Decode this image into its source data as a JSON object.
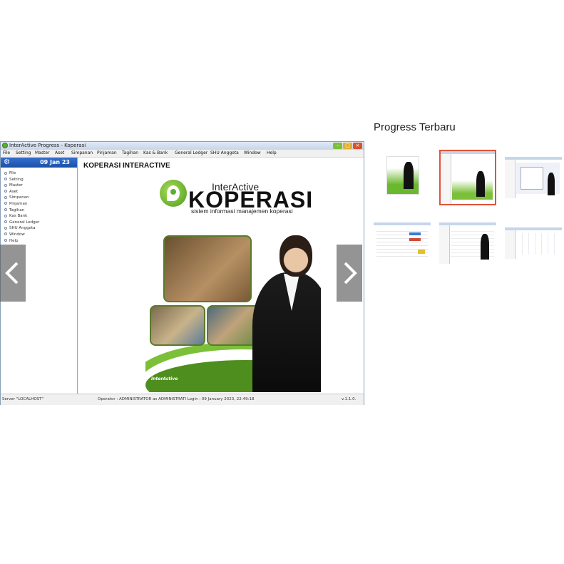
{
  "window": {
    "title": "InterActive Progress - Koperasi",
    "controls": {
      "minimize": "–",
      "maximize": "□",
      "close": "×"
    },
    "menu": [
      "File",
      "Setting",
      "Master",
      "Aset",
      "Simpanan",
      "Pinjaman",
      "Tagihan",
      "Kas & Bank",
      "General Ledger",
      "SHU Anggota",
      "Window",
      "Help"
    ],
    "sidebar": {
      "date": "09 Jan 23",
      "items": [
        "File",
        "Setting",
        "Master",
        "Aset",
        "Simpanan",
        "Pinjaman",
        "Tagihan",
        "Kas  Bank",
        "General Ledger",
        "SHU Anggota",
        "Window",
        "Help"
      ]
    },
    "main": {
      "heading": "KOPERASI INTERACTIVE",
      "cover": {
        "logo_top": "InterActive",
        "logo_main": "KOPERASI",
        "logo_sub": "sistem informasi manajemen koperasi",
        "brand_small": "InterActive"
      }
    },
    "status": {
      "server": "Server \"LOCALHOST\"",
      "operator": "Operator : ADMINISTRATOR as ADMINISTRATI Login : 09 January 2023, 22:49:18",
      "version": "v.1.1.0."
    }
  },
  "gallery": {
    "title": "Progress Terbaru",
    "selected_index": 1,
    "thumbnail_count": 6
  },
  "colors": {
    "accent_green": "#5fae2e",
    "date_header": "#1b4fa8",
    "thumb_selected": "#e0533a"
  }
}
